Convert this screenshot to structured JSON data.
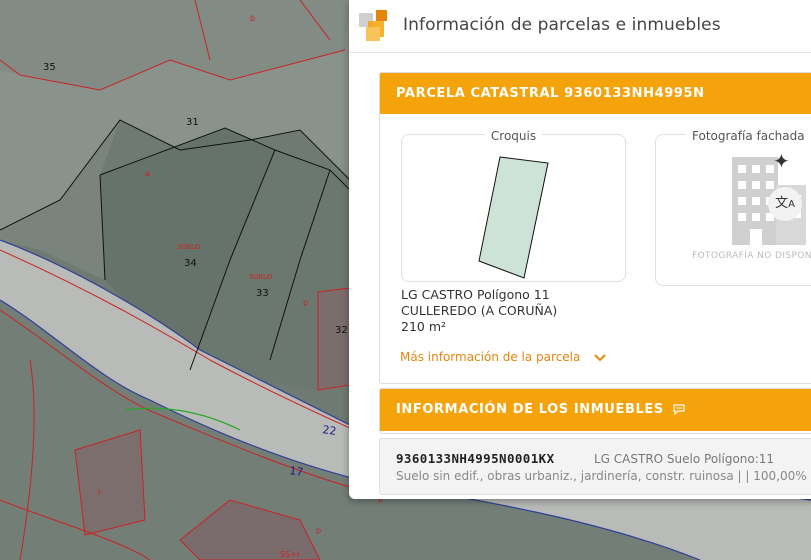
{
  "map": {
    "parcel_numbers": [
      "35",
      "31",
      "34",
      "33",
      "32",
      "22",
      "17"
    ],
    "subparcel_letters": [
      "b",
      "a",
      "p",
      "p",
      "I",
      "p"
    ],
    "use_labels": [
      "SUELO",
      "SUELO",
      "SS+I"
    ],
    "colors": {
      "parcel_fill": "#7d8a82",
      "parcel_light": "#8e968f",
      "road": "#b7b7b7",
      "red_line": "#cc2222",
      "blue_line": "#3333bb"
    }
  },
  "panel": {
    "title": "Información de parcelas e inmuebles",
    "logo_icon": "cadastre-logo-icon",
    "parcel_section": {
      "header": "PARCELA CATASTRAL 9360133NH4995N",
      "croquis_label": "Croquis",
      "photo_label": "Fotografía fachada",
      "photo_unavailable": "FOTOGRAFÍA NO DISPONIBLE",
      "address_line1": "LG CASTRO Polígono 11",
      "address_line2": "CULLEREDO (A CORUÑA)",
      "area": "210 m²",
      "more_info_link": "Más información de la parcela"
    },
    "properties_section": {
      "header": "INFORMACIÓN DE LOS INMUEBLES",
      "items": [
        {
          "ref": "9360133NH4995N0001KX",
          "location": "LG CASTRO Suelo Polígono:11",
          "description": "Suelo sin edif., obras urbaniz., jardinería, constr. ruinosa | | 100,00%"
        }
      ]
    },
    "colors": {
      "accent": "#f5a30b",
      "link": "#e6850e",
      "parcel_sketch_fill": "#cde3d8"
    }
  }
}
